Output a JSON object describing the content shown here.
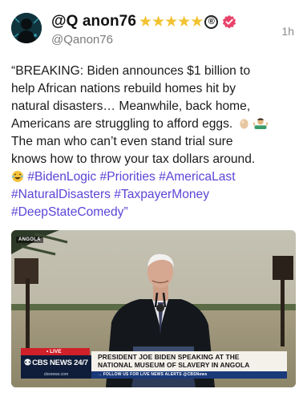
{
  "post": {
    "display_name": "@Q anon76",
    "star_count": 5,
    "registered_mark": "®",
    "handle": "@Qanon76",
    "time": "1h",
    "text_lines": [
      "“BREAKING: Biden announces $1 billion to",
      "help African nations rebuild homes hit by",
      "natural disasters… Meanwhile, back home,",
      "Americans are struggling to afford eggs.",
      "The man who can’t even stand trial sure",
      "knows how to throw your tax dollars around."
    ],
    "hashtags_line1": [
      "#BidenLogic",
      "#Priorities",
      "#AmericaLast"
    ],
    "hashtags_line2": [
      "#NaturalDisasters",
      "#TaxpayerMoney"
    ],
    "hashtags_line3": [
      "#DeepStateComedy"
    ],
    "closing_quote": "”",
    "emojis": [
      "egg-emoji",
      "shrug-emoji",
      "laughing-emoji"
    ],
    "hashtag_color": "#5a45d6"
  },
  "media": {
    "location": "ANGOLA",
    "live_label": "• LIVE",
    "network": "CBS NEWS 24/7",
    "network_url": "cbsnews.com",
    "headline_line1": "PRESIDENT JOE BIDEN SPEAKING AT THE",
    "headline_line2": "NATIONAL MUSEUM OF SLAVERY IN ANGOLA",
    "ticker": "→ FOLLOW US FOR LIVE NEWS ALERTS @CBSNews"
  }
}
